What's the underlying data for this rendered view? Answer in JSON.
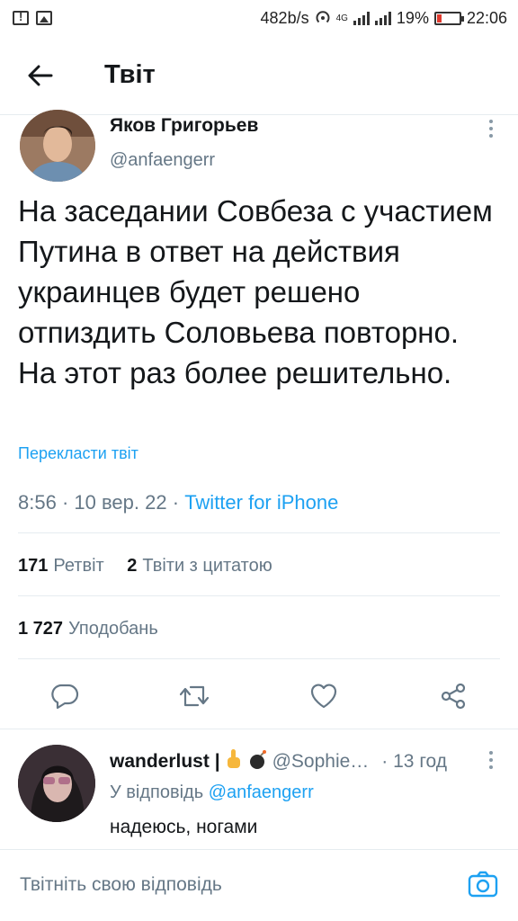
{
  "status_bar": {
    "speed": "482b/s",
    "network": "4G",
    "battery": "19%",
    "battery_level": 0.19,
    "time": "22:06"
  },
  "header": {
    "title": "Твіт"
  },
  "tweet": {
    "author_name": "Яков Григорьев",
    "author_handle": "@anfaengerr",
    "text": "На заседании Совбеза с участием Путина в ответ на действия украинцев будет решено отпиздить Соловьева повторно. На этот раз более решительно.",
    "translate_label": "Перекласти твіт",
    "time": "8:56",
    "date": "10 вер. 22",
    "separator": "·",
    "source": "Twitter for iPhone",
    "retweets_count": "171",
    "retweets_label": "Ретвіт",
    "quotes_count": "2",
    "quotes_label": "Твіти з цитатою",
    "likes_count": "1 727",
    "likes_label": "Уподобань"
  },
  "reply": {
    "name": "wanderlust |",
    "handle": "@Sophie…",
    "time": "· 13 год",
    "reply_to_label": "У відповідь",
    "reply_to_handle": "@anfaengerr",
    "text": "надеюсь, ногами"
  },
  "compose": {
    "placeholder": "Твітніть свою відповідь"
  },
  "colors": {
    "accent": "#1da1f2",
    "secondary_text": "#657786",
    "divider": "#e6ecf0"
  }
}
